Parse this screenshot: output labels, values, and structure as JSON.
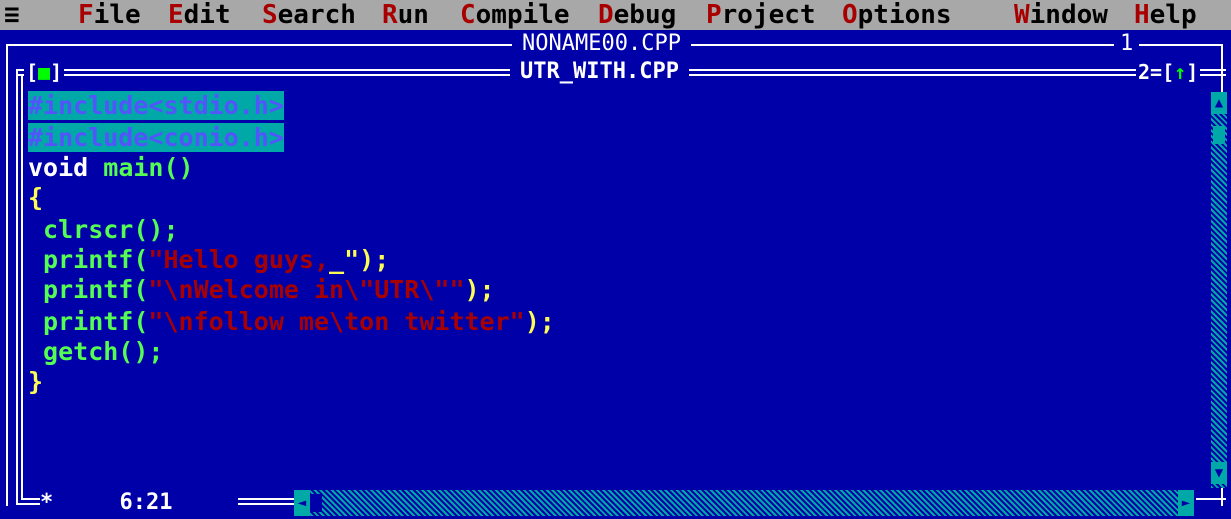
{
  "menu": {
    "sys": "≡",
    "items": [
      {
        "hot": "F",
        "rest": "ile"
      },
      {
        "hot": "E",
        "rest": "dit"
      },
      {
        "hot": "S",
        "rest": "earch"
      },
      {
        "hot": "R",
        "rest": "un"
      },
      {
        "hot": "C",
        "rest": "ompile"
      },
      {
        "hot": "D",
        "rest": "ebug"
      },
      {
        "hot": "P",
        "rest": "roject"
      },
      {
        "hot": "O",
        "rest": "ptions"
      },
      {
        "hot": "W",
        "rest": "indow"
      },
      {
        "hot": "H",
        "rest": "elp"
      }
    ]
  },
  "back_window": {
    "title": "NONAME00.CPP",
    "number": "1"
  },
  "front_window": {
    "title": "UTR_WITH.CPP",
    "number": "2",
    "close_box": "■",
    "zoom_arrow": "↑"
  },
  "code": {
    "l1": "#include<stdio.h>",
    "l2": "#include<conio.h>",
    "l3_kw": "void",
    "l3_fn": " main()",
    "l4": "{",
    "l5": " clrscr();",
    "l6a": " printf(",
    "l6b": "\"Hello guys,",
    "l6c": "_",
    "l6d": "\");",
    "l7a": " printf(",
    "l7b": "\"\\nWelcome in\\\"UTR\\\"\"",
    "l7c": ");",
    "l8a": " printf(",
    "l8b": "\"\\nfollow me\\ton twitter\"",
    "l8c": ");",
    "l9": " getch();",
    "l10": "}"
  },
  "status": {
    "modified": "*",
    "cursor_pos": "6:21"
  }
}
